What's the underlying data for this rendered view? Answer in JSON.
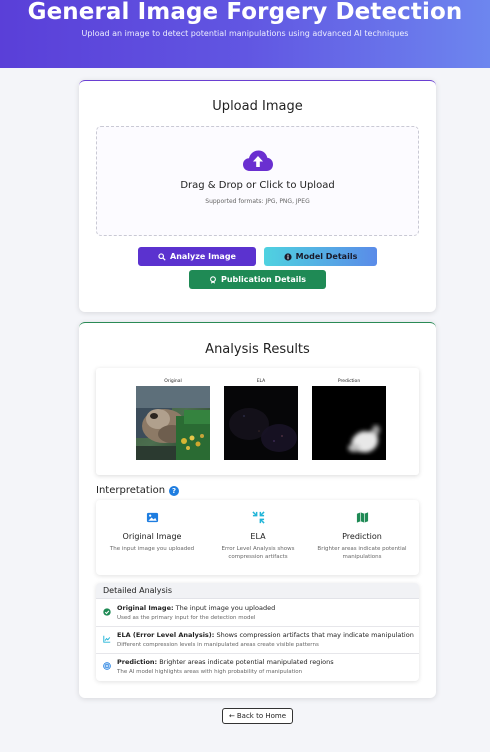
{
  "header": {
    "title": "General Image Forgery Detection",
    "subtitle": "Upload an image to detect potential manipulations using advanced AI techniques"
  },
  "upload": {
    "title": "Upload Image",
    "dropzone_main": "Drag & Drop or Click to Upload",
    "dropzone_formats": "Supported formats: JPG, PNG, JPEG",
    "analyze_label": "Analyze Image",
    "model_label": "Model Details",
    "publication_label": "Publication Details"
  },
  "results": {
    "title": "Analysis Results",
    "thumbs": [
      {
        "label": "Original"
      },
      {
        "label": "ELA"
      },
      {
        "label": "Prediction"
      }
    ]
  },
  "interpretation": {
    "heading": "Interpretation",
    "items": [
      {
        "title": "Original Image",
        "desc": "The input image you uploaded",
        "icon": "image-icon"
      },
      {
        "title": "ELA",
        "desc": "Error Level Analysis shows compression artifacts",
        "icon": "compress-icon"
      },
      {
        "title": "Prediction",
        "desc": "Brighter areas indicate potential manipulations",
        "icon": "map-icon"
      }
    ]
  },
  "detailed": {
    "heading": "Detailed Analysis",
    "rows": [
      {
        "label": "Original Image:",
        "text": "The input image you uploaded",
        "note": "Used as the primary input for the detection model",
        "icon": "check-circle-icon"
      },
      {
        "label": "ELA (Error Level Analysis):",
        "text": "Shows compression artifacts that may indicate manipulation",
        "note": "Different compression levels in manipulated areas create visible patterns",
        "icon": "chart-icon"
      },
      {
        "label": "Prediction:",
        "text": "Brighter areas indicate potential manipulated regions",
        "note": "The AI model highlights areas with high probability of manipulation",
        "icon": "target-icon"
      }
    ]
  },
  "footer": {
    "back_label": "Back to Home"
  },
  "colors": {
    "brand_purple": "#5b32cf",
    "brand_green": "#1f8a55",
    "brand_cyan": "#4fd2e0",
    "info_blue": "#1e7de0"
  }
}
